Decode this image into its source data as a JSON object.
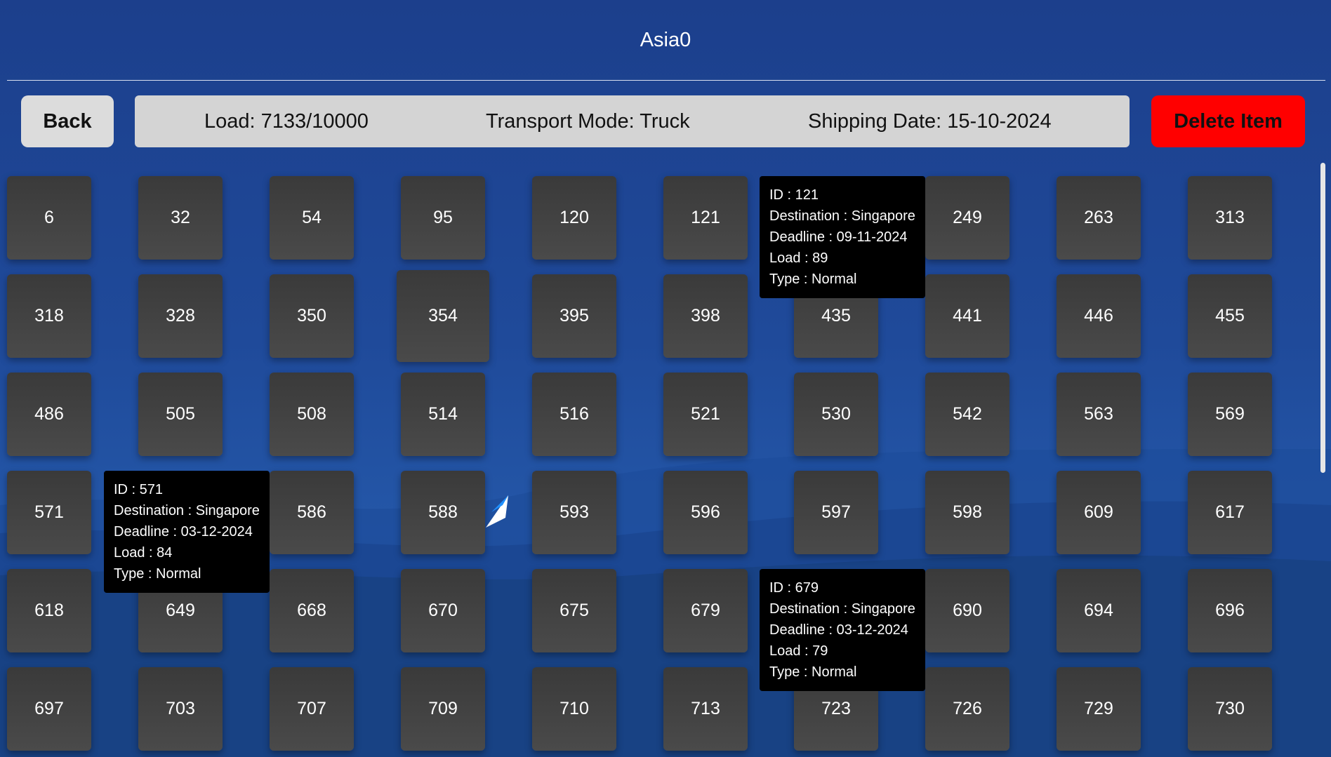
{
  "header": {
    "title": "Asia0"
  },
  "toolbar": {
    "back_label": "Back",
    "load": "Load: 7133/10000",
    "transport_mode": "Transport Mode: Truck",
    "shipping_date": "Shipping Date: 15-10-2024",
    "delete_label": "Delete Item"
  },
  "items": [
    "6",
    "32",
    "54",
    "95",
    "120",
    "121",
    "249",
    "263",
    "313",
    "318",
    "328",
    "350",
    "354",
    "395",
    "398",
    "435",
    "441",
    "446",
    "455",
    "486",
    "505",
    "508",
    "514",
    "516",
    "521",
    "530",
    "542",
    "563",
    "569",
    "571",
    "586",
    "588",
    "593",
    "596",
    "597",
    "598",
    "609",
    "617",
    "618",
    "649",
    "668",
    "670",
    "675",
    "679",
    "690",
    "694",
    "696",
    "697",
    "703",
    "707",
    "709",
    "710",
    "713",
    "723",
    "726",
    "729",
    "730"
  ],
  "tooltips": [
    {
      "id": "ID : 121",
      "destination": "Destination : Singapore",
      "deadline": "Deadline : 09-11-2024",
      "load": "Load : 89",
      "type": "Type : Normal"
    },
    {
      "id": "ID : 571",
      "destination": "Destination : Singapore",
      "deadline": "Deadline : 03-12-2024",
      "load": "Load : 84",
      "type": "Type : Normal"
    },
    {
      "id": "ID : 679",
      "destination": "Destination : Singapore",
      "deadline": "Deadline : 03-12-2024",
      "load": "Load : 79",
      "type": "Type : Normal"
    }
  ],
  "colors": {
    "background": "#1f4a9a",
    "delete": "#ff0000",
    "box": "#414141",
    "tooltip": "#000000"
  }
}
